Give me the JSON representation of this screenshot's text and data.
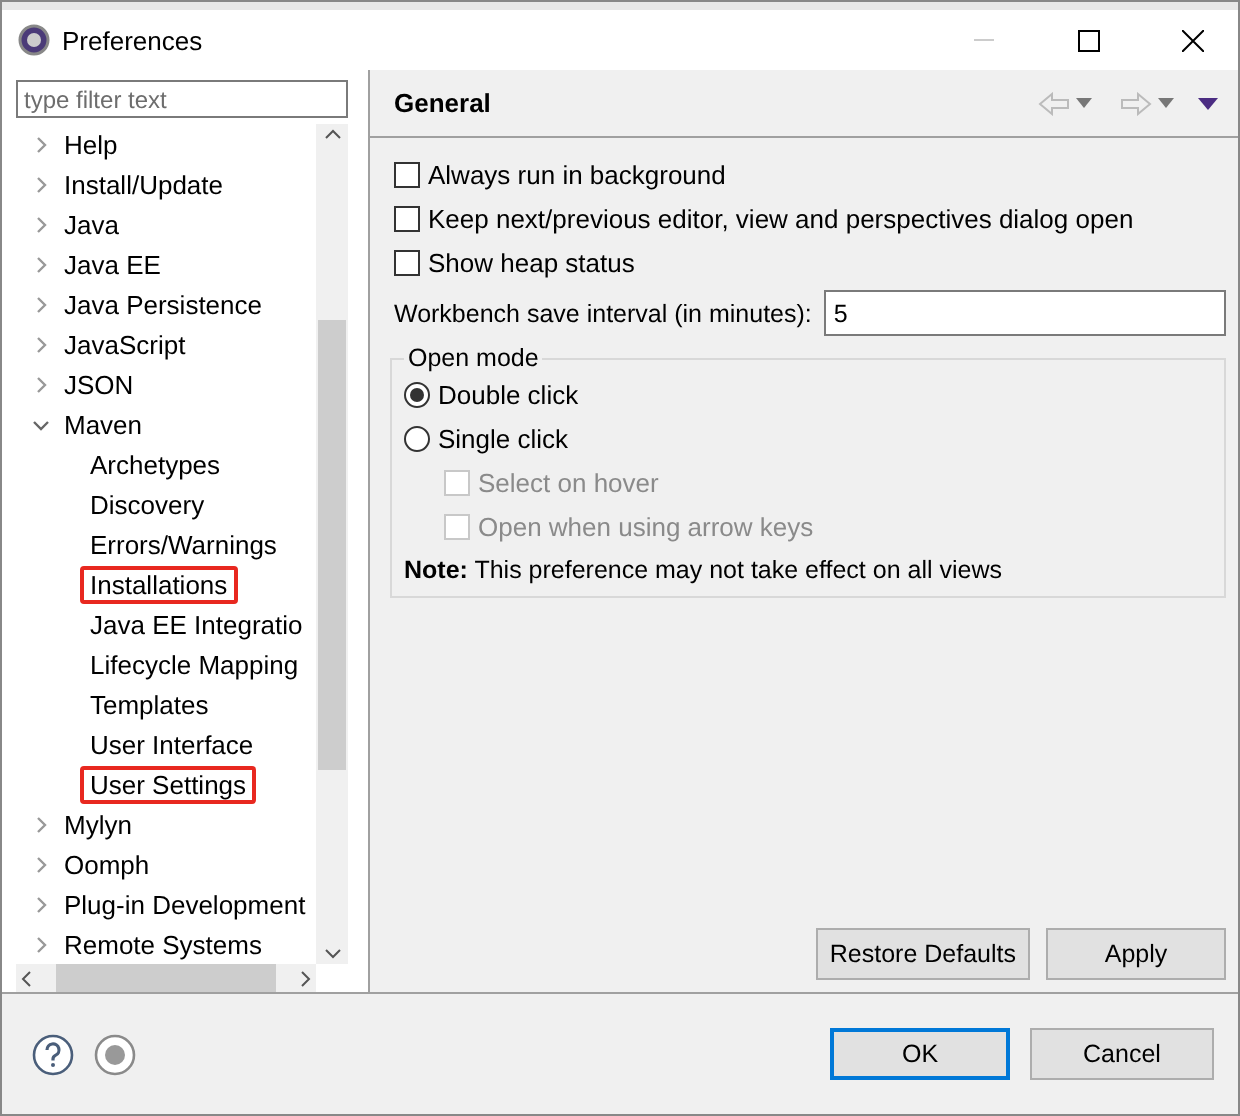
{
  "window": {
    "title": "Preferences"
  },
  "filter": {
    "placeholder": "type filter text"
  },
  "tree": [
    {
      "label": "Help",
      "expanded": false
    },
    {
      "label": "Install/Update",
      "expanded": false
    },
    {
      "label": "Java",
      "expanded": false
    },
    {
      "label": "Java EE",
      "expanded": false
    },
    {
      "label": "Java Persistence",
      "expanded": false
    },
    {
      "label": "JavaScript",
      "expanded": false
    },
    {
      "label": "JSON",
      "expanded": false
    },
    {
      "label": "Maven",
      "expanded": true,
      "children": [
        {
          "label": "Archetypes",
          "highlighted": false
        },
        {
          "label": "Discovery",
          "highlighted": false
        },
        {
          "label": "Errors/Warnings",
          "highlighted": false
        },
        {
          "label": "Installations",
          "highlighted": true
        },
        {
          "label": "Java EE Integratio",
          "highlighted": false
        },
        {
          "label": "Lifecycle Mapping",
          "highlighted": false
        },
        {
          "label": "Templates",
          "highlighted": false
        },
        {
          "label": "User Interface",
          "highlighted": false
        },
        {
          "label": "User Settings",
          "highlighted": true
        }
      ]
    },
    {
      "label": "Mylyn",
      "expanded": false
    },
    {
      "label": "Oomph",
      "expanded": false
    },
    {
      "label": "Plug-in Development",
      "expanded": false
    },
    {
      "label": "Remote Systems",
      "expanded": false
    }
  ],
  "page": {
    "title": "General",
    "options": [
      {
        "label": "Always run in background",
        "checked": false
      },
      {
        "label": "Keep next/previous editor, view and perspectives dialog open",
        "checked": false
      },
      {
        "label": "Show heap status",
        "checked": false
      }
    ],
    "interval": {
      "label": "Workbench save interval (in minutes):",
      "value": "5"
    },
    "open_mode": {
      "title": "Open mode",
      "choices": [
        {
          "label": "Double click",
          "selected": true
        },
        {
          "label": "Single click",
          "selected": false
        }
      ],
      "sub_options": [
        {
          "label": "Select on hover",
          "checked": false,
          "disabled": true
        },
        {
          "label": "Open when using arrow keys",
          "checked": false,
          "disabled": true
        }
      ],
      "note": "**Note:** This preference may not take effect on all views"
    }
  },
  "page_buttons": [
    "Restore Defaults",
    "Apply"
  ],
  "dialog_buttons": [
    {
      "label": "OK",
      "default": true
    },
    {
      "label": "Cancel",
      "default": false
    }
  ]
}
